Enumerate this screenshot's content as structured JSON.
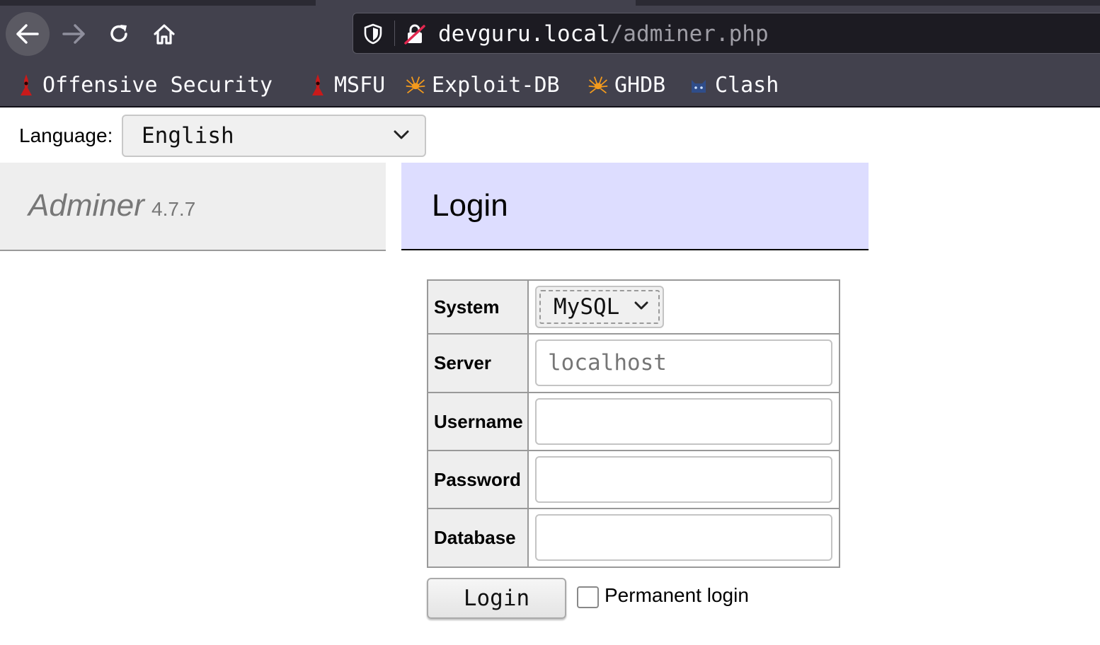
{
  "browser": {
    "url_domain": "devguru.local",
    "url_path": "/adminer.php",
    "bookmarks": [
      {
        "label": "Offensive Security",
        "icon": "offsec-icon"
      },
      {
        "label": "MSFU",
        "icon": "offsec-icon"
      },
      {
        "label": "Exploit-DB",
        "icon": "spider-icon"
      },
      {
        "label": "GHDB",
        "icon": "spider-icon"
      },
      {
        "label": "Clash",
        "icon": "cat-icon"
      }
    ]
  },
  "language": {
    "label": "Language:",
    "selected": "English"
  },
  "app": {
    "name": "Adminer",
    "version": "4.7.7"
  },
  "page": {
    "title": "Login"
  },
  "form": {
    "system_label": "System",
    "system_value": "MySQL",
    "server_label": "Server",
    "server_placeholder": "localhost",
    "username_label": "Username",
    "password_label": "Password",
    "database_label": "Database",
    "submit_label": "Login",
    "permanent_label": "Permanent login"
  },
  "colors": {
    "chrome": "#42414d",
    "url_bar": "#1c1b22",
    "content_header": "#ddddff",
    "sidebar_header": "#eeeeee"
  }
}
